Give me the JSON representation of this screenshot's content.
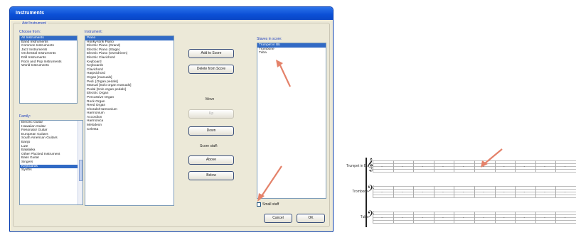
{
  "dialog": {
    "title": "Instruments",
    "group_label": "Add Instrument",
    "choose_from_label": "Choose from:",
    "families": [
      "All Instruments",
      "Band Instruments",
      "Common Instruments",
      "Jazz Instruments",
      "Orchestral Instruments",
      "Drill Instruments",
      "Rock and Pop Instruments",
      "World Instruments"
    ],
    "family_selected": 0,
    "family_label": "Family:",
    "family_items": [
      "Electric Guitar",
      "Hawaiian Guitar",
      "Resonator Guitar",
      "European Guitars",
      "South American Guitars",
      "Banjo",
      "Lute",
      "Balalaika",
      "Other Plucked Instrument",
      "Bass Guitar",
      "Singers",
      "Keyboards",
      "Synths"
    ],
    "family_items_selected": 11,
    "instrument_label": "Instrument:",
    "instruments": [
      "Piano",
      "Honky-tonk Piano",
      "Electric Piano (Grand)",
      "Electric Piano (Stage)",
      "Electric Piano (Overdriven)",
      "Electric Clavichord",
      "Keyboard",
      "Keyboards",
      "Clavichord",
      "Harpsichord",
      "Organ [manuals]",
      "Pedi. [Organ pedals]",
      "Manual [Solo organ manuals]",
      "Pedal [Solo organ pedals]",
      "Electric Organ",
      "Percussive Organ",
      "Rock Organ",
      "Reed Organ",
      "Chorale/Harmonium",
      "Harmonium",
      "Accordion",
      "Harmonica",
      "Melodeon",
      "Celesta"
    ],
    "instrument_selected": 0,
    "add_button": "Add to Score",
    "delete_button": "Delete from Score",
    "move_label": "Move",
    "up_button": "Up",
    "down_button": "Down",
    "score_staff_label": "Score staff:",
    "above_button": "Above",
    "below_button": "Below",
    "staves_label": "Staves in score:",
    "staves": [
      "Trumpet in Bb",
      "Trombone",
      "Tuba"
    ],
    "staves_selected": 0,
    "small_staff_label": "Small staff",
    "cancel_button": "Cancel",
    "ok_button": "OK"
  },
  "score": {
    "instruments": [
      "Trumpet in Bb",
      "Trombone",
      "Tuba"
    ],
    "clefs": [
      "𝄞",
      "𝄢",
      "𝄢"
    ],
    "bars_per_staff": 10,
    "rest_symbol": "-"
  },
  "colors": {
    "arrow": "#e4826a",
    "title_bar": "#0b4fd6",
    "selection": "#316ac5"
  }
}
